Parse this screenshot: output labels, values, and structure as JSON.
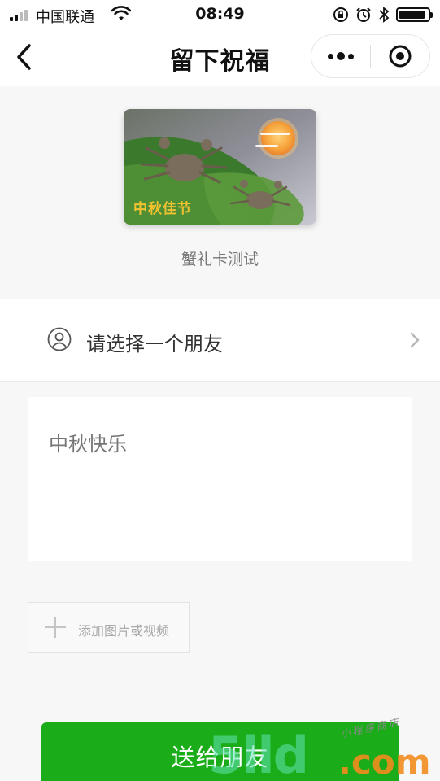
{
  "status_bar": {
    "carrier": "中国联通",
    "time": "08:49"
  },
  "nav": {
    "title": "留下祝福"
  },
  "card": {
    "image_text": "中秋佳节",
    "name": "蟹礼卡测试"
  },
  "friend_select": {
    "label": "请选择一个朋友"
  },
  "message": {
    "text": "中秋快乐"
  },
  "add_media": {
    "label": "添加图片或视频"
  },
  "send_button": {
    "label": "送给朋友"
  },
  "watermark": {
    "big": "5lld",
    "com": ".com",
    "small": "小程序商店"
  },
  "colors": {
    "accent_green": "#1aad19",
    "background": "#f7f7f7"
  }
}
